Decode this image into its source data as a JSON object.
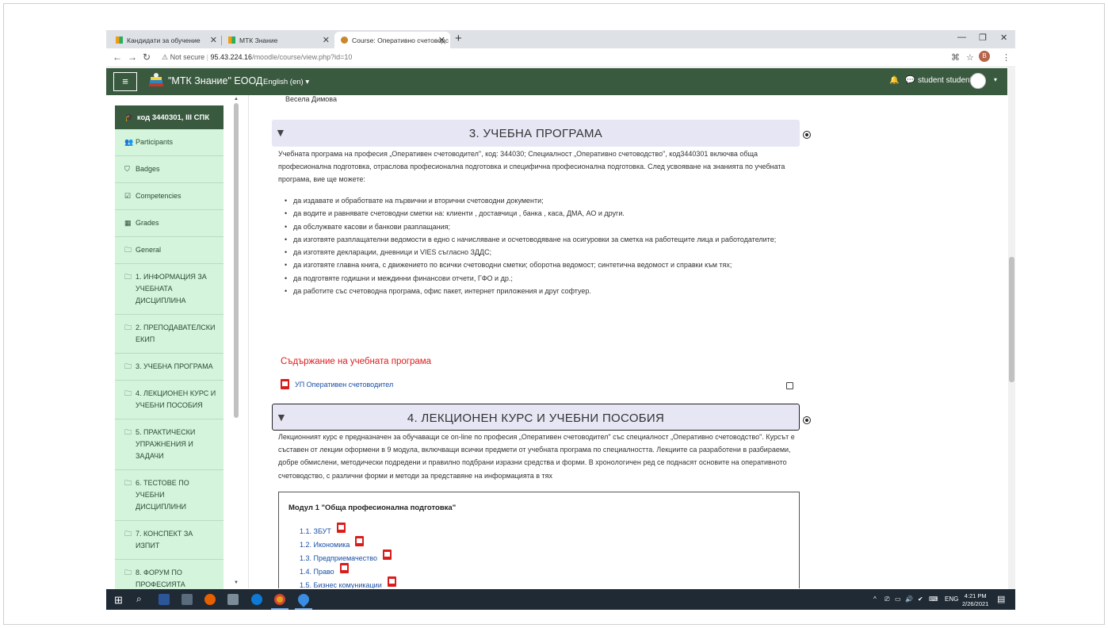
{
  "browser": {
    "tabs": [
      {
        "title": "Кандидати за обучение",
        "active": false
      },
      {
        "title": "МТК Знание",
        "active": false
      },
      {
        "title": "Course: Оперативно счетоводс",
        "active": true
      }
    ],
    "new_tab": "+",
    "url": {
      "security": "Not secure",
      "host": "95.43.224.16",
      "path": "/moodle/course/view.php?id=10"
    },
    "profile_initial": "B"
  },
  "navbar": {
    "brand": "\"МТК Знание\" ЕООД",
    "language": "English (en) ▾",
    "user": "student student",
    "color": "#3a5a40"
  },
  "sidebar": {
    "header": "код 3440301, III СПК",
    "items": [
      {
        "label": "Participants",
        "icon": "users-icon",
        "glyph": "👥"
      },
      {
        "label": "Badges",
        "icon": "shield-icon",
        "glyph": "⛉"
      },
      {
        "label": "Competencies",
        "icon": "checkbox-icon",
        "glyph": "☑"
      },
      {
        "label": "Grades",
        "icon": "table-icon",
        "glyph": "▦"
      },
      {
        "label": "General",
        "icon": "folder-icon",
        "glyph": "🗀"
      },
      {
        "label": "1. ИНФОРМАЦИЯ ЗА УЧЕБНАТА ДИСЦИПЛИНА",
        "icon": "folder-icon",
        "glyph": "🗀"
      },
      {
        "label": "2. ПРЕПОДАВАТЕЛСКИ ЕКИП",
        "icon": "folder-icon",
        "glyph": "🗀"
      },
      {
        "label": "3. УЧЕБНА ПРОГРАМА",
        "icon": "folder-icon",
        "glyph": "🗀"
      },
      {
        "label": "4. ЛЕКЦИОНЕН КУРС И УЧЕБНИ ПОСОБИЯ",
        "icon": "folder-icon",
        "glyph": "🗀"
      },
      {
        "label": "5. ПРАКТИЧЕСКИ УПРАЖНЕНИЯ И ЗАДАЧИ",
        "icon": "folder-icon",
        "glyph": "🗀"
      },
      {
        "label": "6. ТЕСТОВЕ ПО УЧЕБНИ ДИСЦИПЛИНИ",
        "icon": "folder-icon",
        "glyph": "🗀"
      },
      {
        "label": "7. КОНСПЕКТ ЗА ИЗПИТ",
        "icon": "folder-icon",
        "glyph": "🗀"
      },
      {
        "label": "8. ФОРУМ ПО ПРОФЕСИЯТА",
        "icon": "folder-icon",
        "glyph": "🗀"
      }
    ]
  },
  "main": {
    "teacher_name": "Весела Димова",
    "section3": {
      "title": "3. УЧЕБНА ПРОГРАМА",
      "intro": "Учебната програма на професия „Оперативен счетоводител\", код: 344030; Специалност „Оперативно счетоводство\", код3440301 включва обща професионална подготовка, отраслова професионална подготовка и специфична професионална подготовка. След усвояване на знанията по учебната програма, вие ще можете:",
      "bullets": [
        "да издавате и обработвате на първични и вторични счетоводни документи;",
        "да водите и равнявате счетоводни сметки на: клиенти , доставчици , банка , каса, ДМА, АО и други.",
        "да обслужвате касови и банкови разплащания;",
        "да изготвяте разплащателни ведомости в едно с начисляване и осчетоводяване на осигуровки за сметка на работещите лица и работодателите;",
        "да изготвяте декларации, дневници и VIES съгласно ЗДДС;",
        "да изготвяте главна книга, с движението по всички счетоводни сметки; оборотна ведомост; синтетична ведомост и справки към тях;",
        "да подготвяте годишни и междинни финансови отчети, ГФО и др.;",
        "да работите със счетоводна програма, офис пакет, интернет приложения и друг софтуер."
      ],
      "content_title": "Съдържание на учебната програма",
      "resource": "УП Оперативен счетоводител"
    },
    "section4": {
      "title": "4. ЛЕКЦИОНЕН КУРС И УЧЕБНИ ПОСОБИЯ",
      "intro": "Лекционният курс е предназначен за обучаващи се on-line по професия „Оперативен счетоводител\" със специалност „Оперативно счетоводство\". Курсът е съставен от лекции оформени в 9 модула, включващи всички предмети от учебната програма по специалността. Лекциите са разработени в разбираеми, добре обмислени, методически подредени и правилно подбрани изразни средства и форми. В хронологичен ред се поднасят основите на оперативното счетоводство, с различни форми и методи за представяне на информацията в тях",
      "module_title": "Модул 1 \"Обща професионална подготовка\"",
      "module_links": [
        "1.1. ЗБУТ",
        "1.2. Икономика",
        "1.3. Предприемачество",
        "1.4. Право",
        "1.5. Бизнес комуникации"
      ]
    }
  },
  "taskbar": {
    "lang": "ENG",
    "time": "4:21 PM",
    "date": "2/26/2021",
    "notifications": "7"
  }
}
